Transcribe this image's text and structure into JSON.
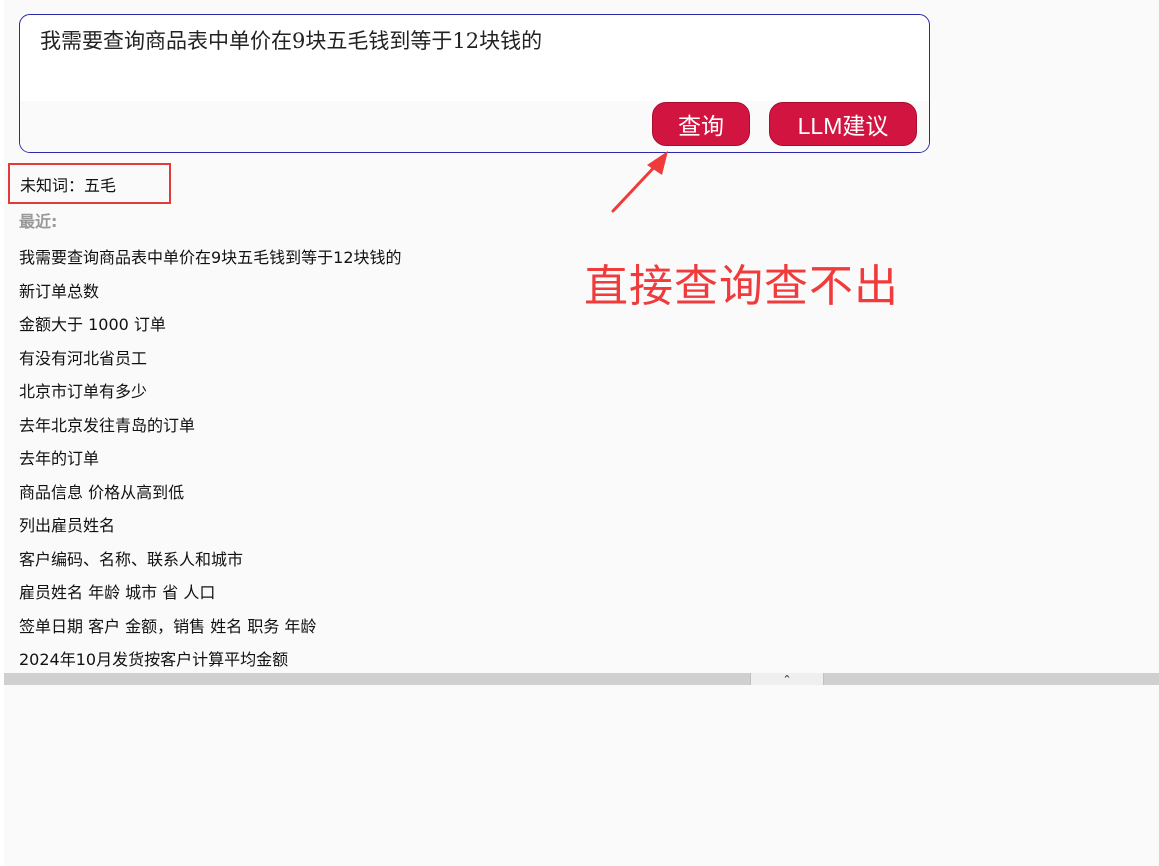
{
  "query": {
    "text": "我需要查询商品表中单价在9块五毛钱到等于12块钱的"
  },
  "buttons": {
    "query_label": "查询",
    "llm_label": "LLM建议"
  },
  "unknown_words": {
    "text": "未知词：五毛"
  },
  "recent": {
    "label": "最近:",
    "items": [
      "我需要查询商品表中单价在9块五毛钱到等于12块钱的",
      "新订单总数",
      "金额大于 1000 订单",
      "有没有河北省员工",
      "北京市订单有多少",
      "去年北京发往青岛的订单",
      "去年的订单",
      "商品信息 价格从高到低",
      "列出雇员姓名",
      "客户编码、名称、联系人和城市",
      "雇员姓名 年龄 城市 省 人口",
      "签单日期 客户 金额，销售 姓名 职务 年龄",
      "2024年10月发货按客户计算平均金额"
    ]
  },
  "annotation": {
    "text": "直接查询查不出"
  },
  "splitter": {
    "handle_icon": "chevron-up-icon",
    "handle_glyph": "⌃"
  },
  "colors": {
    "button_bg": "#d11440",
    "annotation": "#ef3b3b",
    "query_border": "#2a2aa8"
  }
}
